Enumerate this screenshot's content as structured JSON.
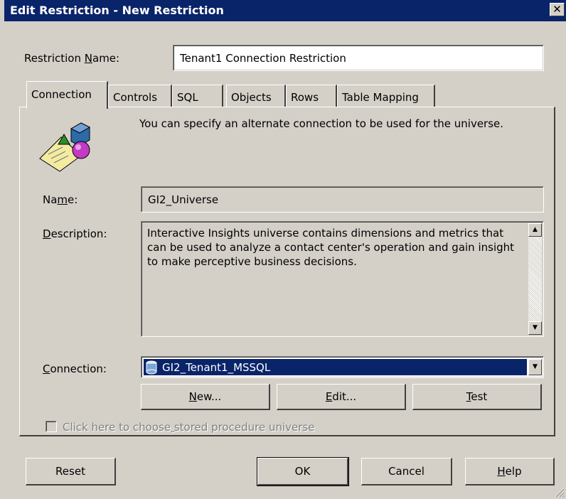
{
  "window": {
    "title": "Edit Restriction - New Restriction",
    "close_glyph": "✕"
  },
  "restriction_name": {
    "label": "Restriction Name:",
    "value": "Tenant1 Connection Restriction"
  },
  "tabs": [
    {
      "label": "Connection",
      "active": true
    },
    {
      "label": "Controls"
    },
    {
      "label": "SQL"
    },
    {
      "label": "Objects"
    },
    {
      "label": "Rows"
    },
    {
      "label": "Table Mapping"
    }
  ],
  "connection_tab": {
    "info_text": "You can specify an alternate connection to be used for the universe.",
    "name_label": "Name:",
    "name_value": "GI2_Universe",
    "description_label": "Description:",
    "description_value": "Interactive Insights universe contains dimensions and metrics that can be used to analyze a contact center's operation and gain insight to make perceptive business decisions.",
    "connection_label": "Connection:",
    "connection_value": "GI2_Tenant1_MSSQL",
    "new_button": "New...",
    "edit_button": "Edit...",
    "test_button": "Test",
    "stored_proc_checkbox": {
      "label": "Click here to choose stored procedure universe",
      "checked": false,
      "enabled": false
    }
  },
  "footer": {
    "reset": "Reset",
    "ok": "OK",
    "cancel": "Cancel",
    "help": "Help"
  },
  "colors": {
    "titlebar": "#0a246a",
    "face": "#d4d0c8",
    "selection": "#0a246a"
  },
  "icons": [
    "close-icon",
    "universe-icon",
    "database-icon",
    "dropdown-arrow-icon",
    "scroll-up-icon",
    "scroll-down-icon",
    "resize-grip-icon"
  ]
}
